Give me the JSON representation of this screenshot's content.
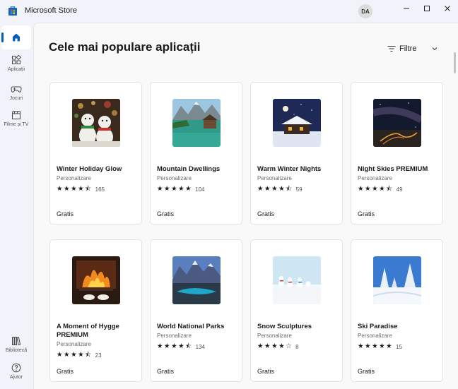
{
  "window": {
    "title": "Microsoft Store",
    "avatar_initials": "DA",
    "controls": [
      "minimize",
      "maximize",
      "close"
    ]
  },
  "sidebar": {
    "items": [
      {
        "label": "",
        "icon": "home-icon",
        "selected": true
      },
      {
        "label": "Aplicații",
        "icon": "apps-icon"
      },
      {
        "label": "Jocuri",
        "icon": "gamepad-icon"
      },
      {
        "label": "Filme și TV",
        "icon": "clapper-icon"
      },
      {
        "label": "Bibliotecă",
        "icon": "library-icon"
      },
      {
        "label": "Ajutor",
        "icon": "help-icon"
      }
    ]
  },
  "main": {
    "title": "Cele mai populare aplicații",
    "filter_label": "Filtre",
    "accent_color": "#005fb8"
  },
  "cards": [
    {
      "name": "Winter Holiday Glow",
      "category": "Personalizare",
      "rating": 4.5,
      "reviews": "165",
      "price": "Gratis",
      "thumb": "snowmen"
    },
    {
      "name": "Mountain Dwellings",
      "category": "Personalizare",
      "rating": 5,
      "reviews": "104",
      "price": "Gratis",
      "thumb": "lake"
    },
    {
      "name": "Warm Winter Nights",
      "category": "Personalizare",
      "rating": 4.5,
      "reviews": "59",
      "price": "Gratis",
      "thumb": "cabin"
    },
    {
      "name": "Night Skies PREMIUM",
      "category": "Personalizare",
      "rating": 4.5,
      "reviews": "49",
      "price": "Gratis",
      "thumb": "nightsky"
    },
    {
      "name": "A Moment of Hygge PREMIUM",
      "category": "Personalizare",
      "rating": 4.5,
      "reviews": "23",
      "price": "Gratis",
      "thumb": "fire"
    },
    {
      "name": "World National Parks",
      "category": "Personalizare",
      "rating": 4.5,
      "reviews": "134",
      "price": "Gratis",
      "thumb": "mountains"
    },
    {
      "name": "Snow Sculptures",
      "category": "Personalizare",
      "rating": 4,
      "reviews": "8",
      "price": "Gratis",
      "thumb": "snowfigures"
    },
    {
      "name": "Ski Paradise",
      "category": "Personalizare",
      "rating": 5,
      "reviews": "15",
      "price": "Gratis",
      "thumb": "snowtrees"
    }
  ]
}
